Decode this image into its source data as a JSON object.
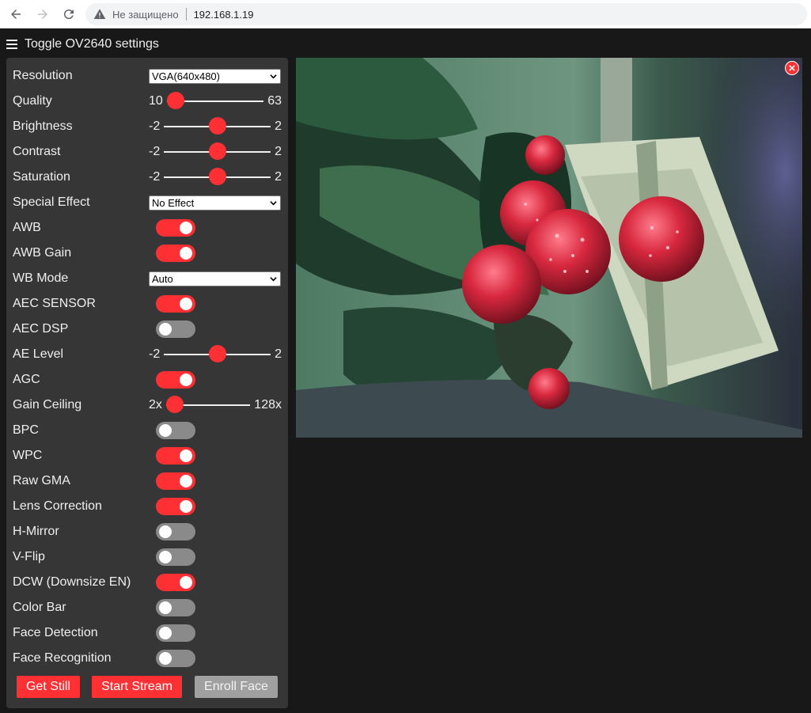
{
  "browser": {
    "security_text": "Не защищено",
    "url": "192.168.1.19"
  },
  "header": {
    "toggle_label": "Toggle OV2640 settings"
  },
  "settings": [
    {
      "label": "Resolution",
      "type": "select",
      "value": "VGA(640x480)"
    },
    {
      "label": "Quality",
      "type": "range",
      "min": "10",
      "max": "63",
      "fraction": 0.0
    },
    {
      "label": "Brightness",
      "type": "range",
      "min": "-2",
      "max": "2",
      "fraction": 0.5
    },
    {
      "label": "Contrast",
      "type": "range",
      "min": "-2",
      "max": "2",
      "fraction": 0.5
    },
    {
      "label": "Saturation",
      "type": "range",
      "min": "-2",
      "max": "2",
      "fraction": 0.5
    },
    {
      "label": "Special Effect",
      "type": "select",
      "value": "No Effect"
    },
    {
      "label": "AWB",
      "type": "switch",
      "on": true
    },
    {
      "label": "AWB Gain",
      "type": "switch",
      "on": true
    },
    {
      "label": "WB Mode",
      "type": "select",
      "value": "Auto"
    },
    {
      "label": "AEC SENSOR",
      "type": "switch",
      "on": true
    },
    {
      "label": "AEC DSP",
      "type": "switch",
      "on": false
    },
    {
      "label": "AE Level",
      "type": "range",
      "min": "-2",
      "max": "2",
      "fraction": 0.5
    },
    {
      "label": "AGC",
      "type": "switch",
      "on": true
    },
    {
      "label": "Gain Ceiling",
      "type": "range",
      "min": "2x",
      "max": "128x",
      "fraction": 0.0
    },
    {
      "label": "BPC",
      "type": "switch",
      "on": false
    },
    {
      "label": "WPC",
      "type": "switch",
      "on": true
    },
    {
      "label": "Raw GMA",
      "type": "switch",
      "on": true
    },
    {
      "label": "Lens Correction",
      "type": "switch",
      "on": true
    },
    {
      "label": "H-Mirror",
      "type": "switch",
      "on": false
    },
    {
      "label": "V-Flip",
      "type": "switch",
      "on": false
    },
    {
      "label": "DCW (Downsize EN)",
      "type": "switch",
      "on": true
    },
    {
      "label": "Color Bar",
      "type": "switch",
      "on": false
    },
    {
      "label": "Face Detection",
      "type": "switch",
      "on": false
    },
    {
      "label": "Face Recognition",
      "type": "switch",
      "on": false
    }
  ],
  "buttons": {
    "get_still": "Get Still",
    "start_stream": "Start Stream",
    "enroll_face": "Enroll Face"
  },
  "colors": {
    "accent": "#ff3034",
    "panel": "#363636",
    "background": "#181818",
    "switch_off": "#8a8a8a"
  }
}
